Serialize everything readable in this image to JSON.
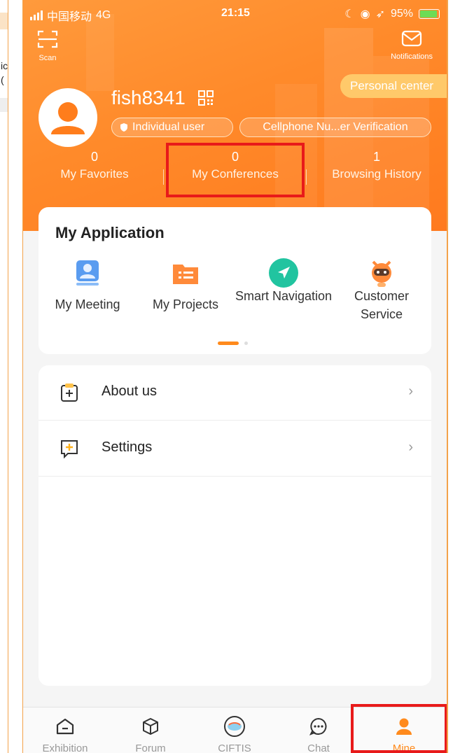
{
  "status_bar": {
    "carrier": "中国移动",
    "network": "4G",
    "time": "21:15",
    "battery": "95%"
  },
  "header": {
    "scan_label": "Scan",
    "notifications_label": "Notifications",
    "personal_center": "Personal center"
  },
  "profile": {
    "username": "fish8341",
    "badge_user": "Individual user",
    "badge_verify": "Cellphone Nu...er Verification"
  },
  "stats": [
    {
      "value": "0",
      "label": "My Favorites"
    },
    {
      "value": "0",
      "label": "My Conferences"
    },
    {
      "value": "1",
      "label": "Browsing History"
    }
  ],
  "applications": {
    "title": "My Application",
    "items": [
      {
        "label": "My Meeting",
        "icon": "meeting-icon"
      },
      {
        "label": "My Projects",
        "icon": "projects-icon"
      },
      {
        "label": "Smart Navigation",
        "icon": "navigation-icon"
      },
      {
        "label": "Customer Service",
        "icon": "robot-service-icon"
      }
    ]
  },
  "menu": [
    {
      "label": "About us",
      "icon": "about-icon"
    },
    {
      "label": "Settings",
      "icon": "settings-icon"
    }
  ],
  "tabs": [
    {
      "label": "Exhibition",
      "icon": "exhibition-icon"
    },
    {
      "label": "Forum",
      "icon": "forum-cube-icon"
    },
    {
      "label": "CIFTIS",
      "icon": "ciftis-logo-icon"
    },
    {
      "label": "Chat",
      "icon": "chat-icon"
    },
    {
      "label": "Mine",
      "icon": "person-icon",
      "active": true
    }
  ],
  "colors": {
    "accent": "#ff8a1c",
    "highlight_box": "#e81a1a"
  }
}
